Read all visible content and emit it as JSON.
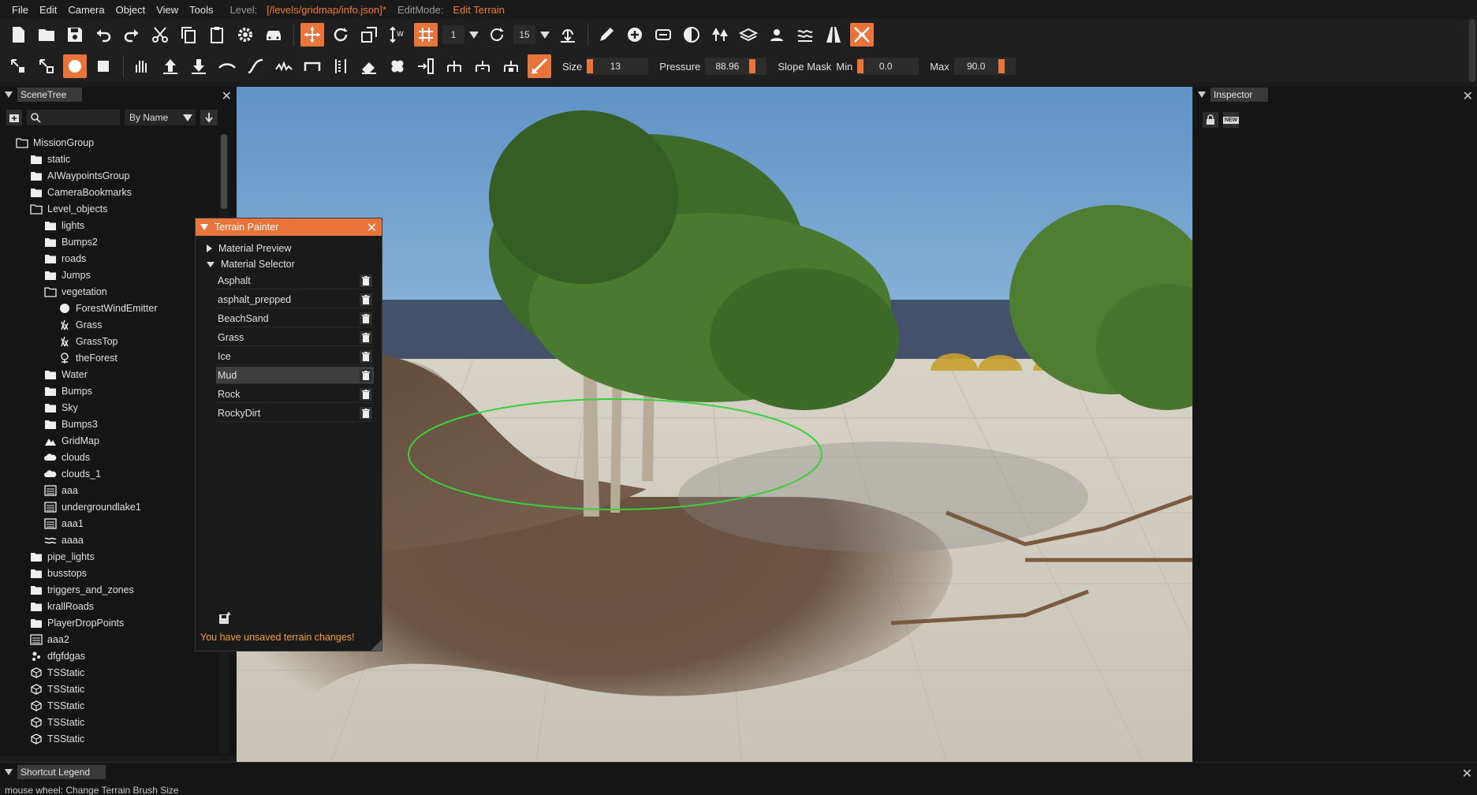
{
  "menubar": {
    "items": [
      "File",
      "Edit",
      "Camera",
      "Object",
      "View",
      "Tools"
    ],
    "level_label": "Level:",
    "level_value": "[/levels/gridmap/info.json]*",
    "editmode_label": "EditMode:",
    "editmode_value": "Edit Terrain"
  },
  "toolbar1": {
    "snap_value": "1",
    "rotate_snap_value": "15"
  },
  "toolbar2": {
    "size_label": "Size",
    "size_value": "13",
    "pressure_label": "Pressure",
    "pressure_value": "88.96",
    "slope_mask_label": "Slope Mask",
    "min_label": "Min",
    "min_value": "0.0",
    "max_label": "Max",
    "max_value": "90.0"
  },
  "scenetree": {
    "title": "SceneTree",
    "sort_option": "By Name",
    "items": [
      {
        "label": "MissionGroup",
        "indent": 0,
        "icon": "folder-open-icon"
      },
      {
        "label": "static",
        "indent": 1,
        "icon": "folder-icon"
      },
      {
        "label": "AIWaypointsGroup",
        "indent": 1,
        "icon": "folder-icon"
      },
      {
        "label": "CameraBookmarks",
        "indent": 1,
        "icon": "folder-icon"
      },
      {
        "label": "Level_objects",
        "indent": 1,
        "icon": "folder-open-icon"
      },
      {
        "label": "lights",
        "indent": 2,
        "icon": "folder-icon"
      },
      {
        "label": "Bumps2",
        "indent": 2,
        "icon": "folder-icon"
      },
      {
        "label": "roads",
        "indent": 2,
        "icon": "folder-icon"
      },
      {
        "label": "Jumps",
        "indent": 2,
        "icon": "folder-icon"
      },
      {
        "label": "vegetation",
        "indent": 2,
        "icon": "folder-open-icon"
      },
      {
        "label": "ForestWindEmitter",
        "indent": 3,
        "icon": "sphere-icon"
      },
      {
        "label": "Grass",
        "indent": 3,
        "icon": "grass-icon"
      },
      {
        "label": "GrassTop",
        "indent": 3,
        "icon": "grass-icon"
      },
      {
        "label": "theForest",
        "indent": 3,
        "icon": "forest-icon"
      },
      {
        "label": "Water",
        "indent": 2,
        "icon": "folder-icon"
      },
      {
        "label": "Bumps",
        "indent": 2,
        "icon": "folder-icon"
      },
      {
        "label": "Sky",
        "indent": 2,
        "icon": "folder-icon"
      },
      {
        "label": "Bumps3",
        "indent": 2,
        "icon": "folder-icon"
      },
      {
        "label": "GridMap",
        "indent": 2,
        "icon": "terrain-icon"
      },
      {
        "label": "clouds",
        "indent": 2,
        "icon": "cloud-icon"
      },
      {
        "label": "clouds_1",
        "indent": 2,
        "icon": "cloud-icon"
      },
      {
        "label": "aaa",
        "indent": 2,
        "icon": "water-plane-icon"
      },
      {
        "label": "undergroundlake1",
        "indent": 2,
        "icon": "water-plane-icon"
      },
      {
        "label": "aaa1",
        "indent": 2,
        "icon": "water-plane-icon"
      },
      {
        "label": "aaaa",
        "indent": 2,
        "icon": "waves-icon"
      },
      {
        "label": "pipe_lights",
        "indent": 1,
        "icon": "folder-icon"
      },
      {
        "label": "busstops",
        "indent": 1,
        "icon": "folder-icon"
      },
      {
        "label": "triggers_and_zones",
        "indent": 1,
        "icon": "folder-icon"
      },
      {
        "label": "krallRoads",
        "indent": 1,
        "icon": "folder-icon"
      },
      {
        "label": "PlayerDropPoints",
        "indent": 1,
        "icon": "folder-icon"
      },
      {
        "label": "aaa2",
        "indent": 1,
        "icon": "water-plane-icon"
      },
      {
        "label": "dfgfdgas",
        "indent": 1,
        "icon": "particle-icon"
      },
      {
        "label": "TSStatic",
        "indent": 1,
        "icon": "mesh-icon"
      },
      {
        "label": "TSStatic",
        "indent": 1,
        "icon": "mesh-icon"
      },
      {
        "label": "TSStatic",
        "indent": 1,
        "icon": "mesh-icon"
      },
      {
        "label": "TSStatic",
        "indent": 1,
        "icon": "mesh-icon"
      },
      {
        "label": "TSStatic",
        "indent": 1,
        "icon": "mesh-icon"
      }
    ]
  },
  "terrain_painter": {
    "title": "Terrain Painter",
    "material_preview_label": "Material Preview",
    "material_selector_label": "Material Selector",
    "materials": [
      "Asphalt",
      "asphalt_prepped",
      "BeachSand",
      "Grass",
      "Ice",
      "Mud",
      "Rock",
      "RockyDirt"
    ],
    "selected_material": "Mud",
    "unsaved_message": "You have unsaved terrain changes!"
  },
  "inspector": {
    "title": "Inspector",
    "new_button_label": "NEW"
  },
  "shortcut_legend": {
    "title": "Shortcut Legend",
    "line": "mouse wheel: Change Terrain Brush Size"
  },
  "colors": {
    "accent": "#e8743b",
    "brush_outline": "#3ccf3c",
    "warning": "#f0a040"
  }
}
